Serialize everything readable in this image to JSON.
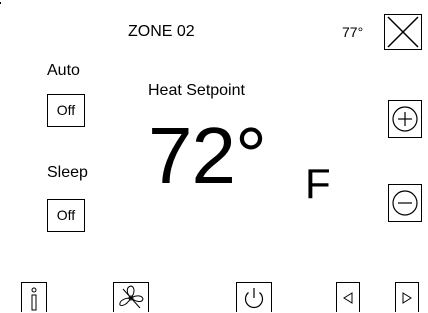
{
  "header": {
    "zone_title": "ZONE 02",
    "outside_temperature": "77°",
    "close_icon": "close-icon"
  },
  "auto": {
    "label": "Auto",
    "button_label": "Off"
  },
  "sleep": {
    "label": "Sleep",
    "button_label": "Off"
  },
  "setpoint": {
    "label": "Heat Setpoint",
    "value": "72°",
    "unit": "F",
    "increase_icon": "plus-circle-icon",
    "decrease_icon": "minus-circle-icon"
  },
  "bottom_bar": {
    "icons": [
      "info-icon",
      "fan-icon",
      "power-icon",
      "previous-icon",
      "next-icon"
    ]
  }
}
